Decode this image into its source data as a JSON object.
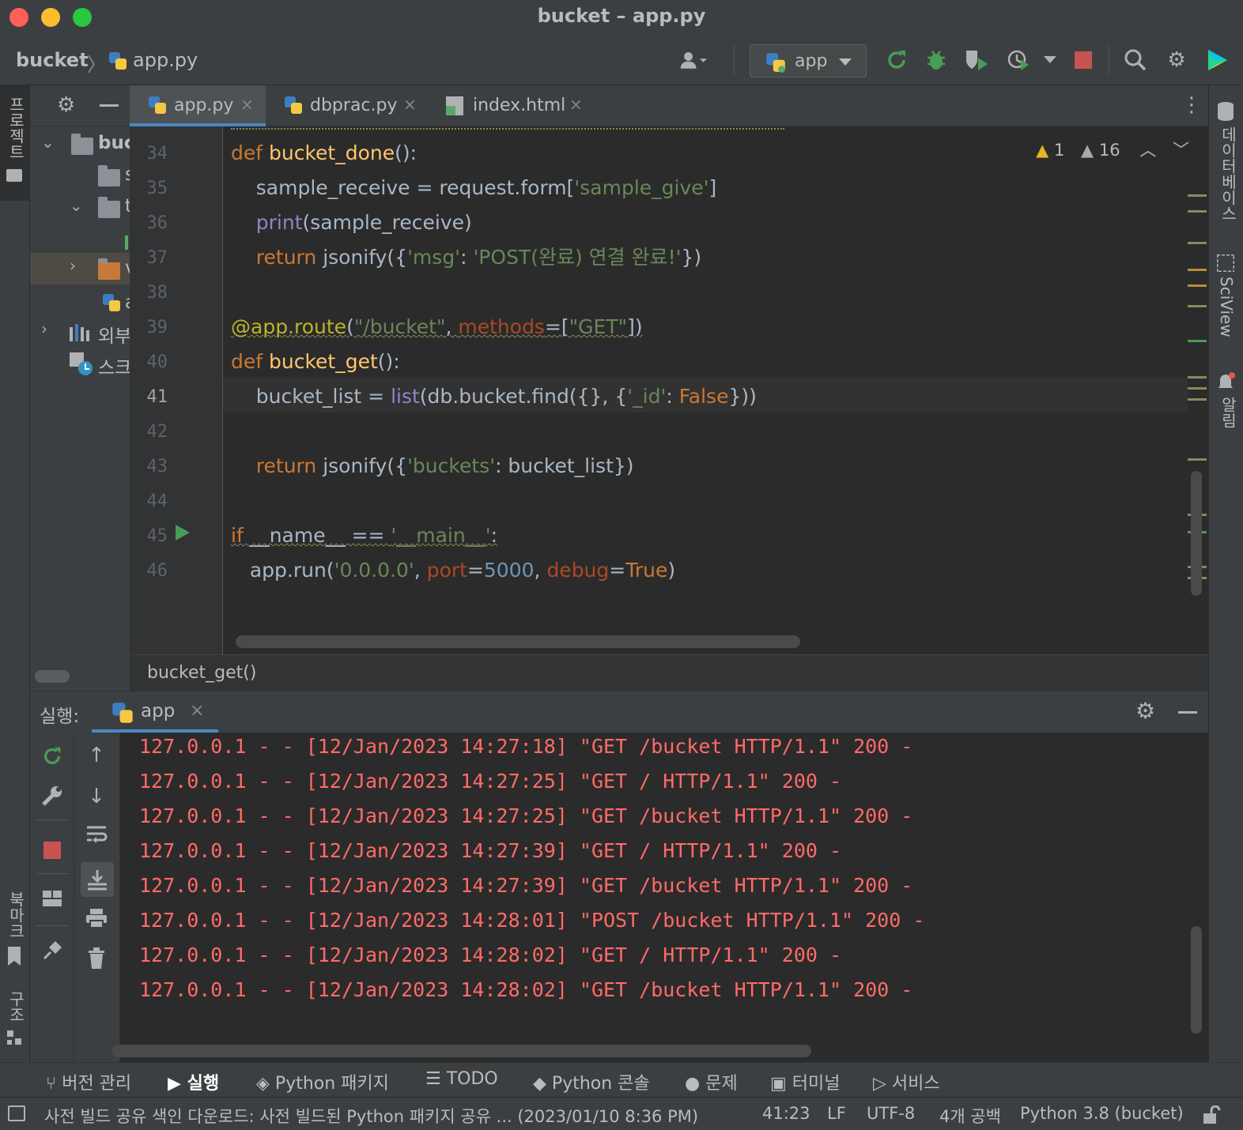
{
  "window": {
    "title": "bucket – app.py"
  },
  "breadcrumb": {
    "project": "bucket",
    "file": "app.py"
  },
  "toolbar": {
    "run_config": "app"
  },
  "left_strip": {
    "project_label": "프로젝트",
    "bookmarks_label": "북마크",
    "structure_label": "구조"
  },
  "right_strip": {
    "database_label": "데이터베이스",
    "sciview_label": "SciView",
    "notifications_label": "알림"
  },
  "project_tree": {
    "items": [
      {
        "label": "buc"
      },
      {
        "label": "s"
      },
      {
        "label": "t"
      },
      {
        "label": "v"
      },
      {
        "label": "a"
      },
      {
        "label": "외부"
      },
      {
        "label": "스크"
      }
    ]
  },
  "tabs": [
    {
      "label": "app.py",
      "active": true
    },
    {
      "label": "dbprac.py",
      "active": false
    },
    {
      "label": "index.html",
      "active": false
    }
  ],
  "inspections": {
    "warnings_weak": "1",
    "warnings": "16"
  },
  "editor": {
    "current_line": "41",
    "lines": [
      {
        "n": "34"
      },
      {
        "n": "35"
      },
      {
        "n": "36"
      },
      {
        "n": "37"
      },
      {
        "n": "38"
      },
      {
        "n": "39"
      },
      {
        "n": "40"
      },
      {
        "n": "41"
      },
      {
        "n": "42"
      },
      {
        "n": "43"
      },
      {
        "n": "44"
      },
      {
        "n": "45"
      },
      {
        "n": "46"
      }
    ],
    "code": {
      "l34_kw": "def ",
      "l34_fn": "bucket_done",
      "l34_rest": "():",
      "l35_a": "    sample_receive = request.form[",
      "l35_str": "'sample_give'",
      "l35_b": "]",
      "l36_builtin": "    print",
      "l36_rest": "(sample_receive)",
      "l37_kw": "    return ",
      "l37_a": "jsonify({",
      "l37_s1": "'msg'",
      "l37_b": ": ",
      "l37_s2": "'POST(완료) 연결 완료!'",
      "l37_c": "})",
      "l39_deco": "@app.route",
      "l39_a": "(",
      "l39_s1": "\"/bucket\"",
      "l39_b": ", ",
      "l39_param": "methods",
      "l39_c": "=[",
      "l39_s2": "\"GET\"",
      "l39_d": "])",
      "l40_kw": "def ",
      "l40_fn": "bucket_get",
      "l40_rest": "():",
      "l41_a": "    bucket_list = ",
      "l41_builtin": "list",
      "l41_b": "(db.bucket.find({}, {",
      "l41_s": "'_id'",
      "l41_c": ": ",
      "l41_kw": "False",
      "l41_d": "}))",
      "l43_kw": "    return ",
      "l43_a": "jsonify({",
      "l43_s": "'buckets'",
      "l43_b": ": bucket_list})",
      "l45_kw": "if ",
      "l45_a": "__name__ == ",
      "l45_s": "'__main__'",
      "l45_b": ":",
      "l46_a": "   app.run(",
      "l46_s": "'0.0.0.0'",
      "l46_b": ", ",
      "l46_p1": "port",
      "l46_c": "=",
      "l46_num": "5000",
      "l46_d": ", ",
      "l46_p2": "debug",
      "l46_e": "=",
      "l46_kw": "True",
      "l46_f": ")"
    },
    "breadcrumb": "bucket_get()"
  },
  "run_panel": {
    "label": "실행:",
    "tab": "app",
    "log": [
      "127.0.0.1 - - [12/Jan/2023 14:27:18] \"GET /bucket HTTP/1.1\" 200 -",
      "127.0.0.1 - - [12/Jan/2023 14:27:25] \"GET / HTTP/1.1\" 200 -",
      "127.0.0.1 - - [12/Jan/2023 14:27:25] \"GET /bucket HTTP/1.1\" 200 -",
      "127.0.0.1 - - [12/Jan/2023 14:27:39] \"GET / HTTP/1.1\" 200 -",
      "127.0.0.1 - - [12/Jan/2023 14:27:39] \"GET /bucket HTTP/1.1\" 200 -",
      "127.0.0.1 - - [12/Jan/2023 14:28:01] \"POST /bucket HTTP/1.1\" 200 -",
      "127.0.0.1 - - [12/Jan/2023 14:28:02] \"GET / HTTP/1.1\" 200 -",
      "127.0.0.1 - - [12/Jan/2023 14:28:02] \"GET /bucket HTTP/1.1\" 200 -"
    ]
  },
  "tool_windows": [
    {
      "label": "버전 관리",
      "icon": "branch-icon"
    },
    {
      "label": "실행",
      "icon": "run-icon",
      "active": true
    },
    {
      "label": "Python 패키지",
      "icon": "layers-icon"
    },
    {
      "label": "TODO",
      "icon": "list-icon"
    },
    {
      "label": "Python 콘솔",
      "icon": "python-icon"
    },
    {
      "label": "문제",
      "icon": "alert-icon"
    },
    {
      "label": "터미널",
      "icon": "terminal-icon"
    },
    {
      "label": "서비스",
      "icon": "services-icon"
    }
  ],
  "status_bar": {
    "message": "사전 빌드 공유 색인 다운로드: 사전 빌드된 Python 패키지 공유 ... (2023/01/10 8:36 PM)",
    "position": "41:23",
    "line_ending": "LF",
    "encoding": "UTF-8",
    "indent": "4개 공백",
    "interpreter": "Python 3.8 (bucket)"
  },
  "colors": {
    "accent": "#4a88c7",
    "console_text": "#ff6b68",
    "run_green": "#499c54",
    "stop_red": "#c75450"
  }
}
